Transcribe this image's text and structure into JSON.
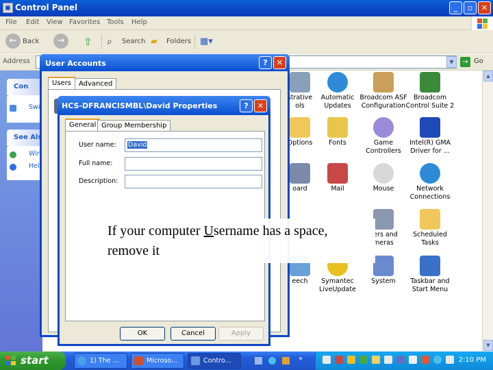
{
  "control_panel": {
    "title": "Control Panel",
    "menu": [
      "File",
      "Edit",
      "View",
      "Favorites",
      "Tools",
      "Help"
    ],
    "toolbar": {
      "back": "Back",
      "search": "Search",
      "folders": "Folders"
    },
    "address_label": "Address",
    "go_label": "Go",
    "left_pane": {
      "header1": "Con",
      "link1": "Swi",
      "header2": "See Als",
      "link2": "Win",
      "link3": "Hel"
    },
    "items": [
      {
        "label": "strative\nols"
      },
      {
        "label": "Automatic\nUpdates"
      },
      {
        "label": "Broadcom ASF\nConfiguration"
      },
      {
        "label": "Broadcom\nControl Suite 2"
      },
      {
        "label": "Options"
      },
      {
        "label": "Fonts"
      },
      {
        "label": "Game\nControllers"
      },
      {
        "label": "Intel(R) GMA\nDriver for ..."
      },
      {
        "label": "oard"
      },
      {
        "label": "Mail"
      },
      {
        "label": "Mouse"
      },
      {
        "label": "Network\nConnections"
      },
      {
        "label": "ners and\nmeras"
      },
      {
        "label": "Scheduled\nTasks"
      },
      {
        "label": "eech"
      },
      {
        "label": "Symantec\nLiveUpdate"
      },
      {
        "label": "System"
      },
      {
        "label": "Taskbar and\nStart Menu"
      }
    ]
  },
  "user_accounts": {
    "title": "User Accounts",
    "tabs": [
      "Users",
      "Advanced"
    ]
  },
  "properties": {
    "title": "HCS-DFRANCISMBL\\David Properties",
    "tabs": [
      "General",
      "Group Membership"
    ],
    "fields": {
      "username_label": "User name:",
      "username_value": "David",
      "fullname_label": "Full name:",
      "fullname_value": "",
      "description_label": "Description:",
      "description_value": ""
    },
    "buttons": {
      "ok": "OK",
      "cancel": "Cancel",
      "apply": "Apply"
    }
  },
  "caption": {
    "line1_before": "If your computer ",
    "line1_underlined": "U",
    "line1_after": "sername has a space,",
    "line2": "remove it"
  },
  "taskbar": {
    "start": "start",
    "buttons": [
      "1) The ...",
      "Microso...",
      "Contro..."
    ],
    "clock": "2:10 PM"
  },
  "colors": {
    "xp_blue_title": "#0a4fd0",
    "start_green": "#2e9a2e",
    "tray_blue": "#0e8ad9",
    "selection": "#316ac5"
  }
}
